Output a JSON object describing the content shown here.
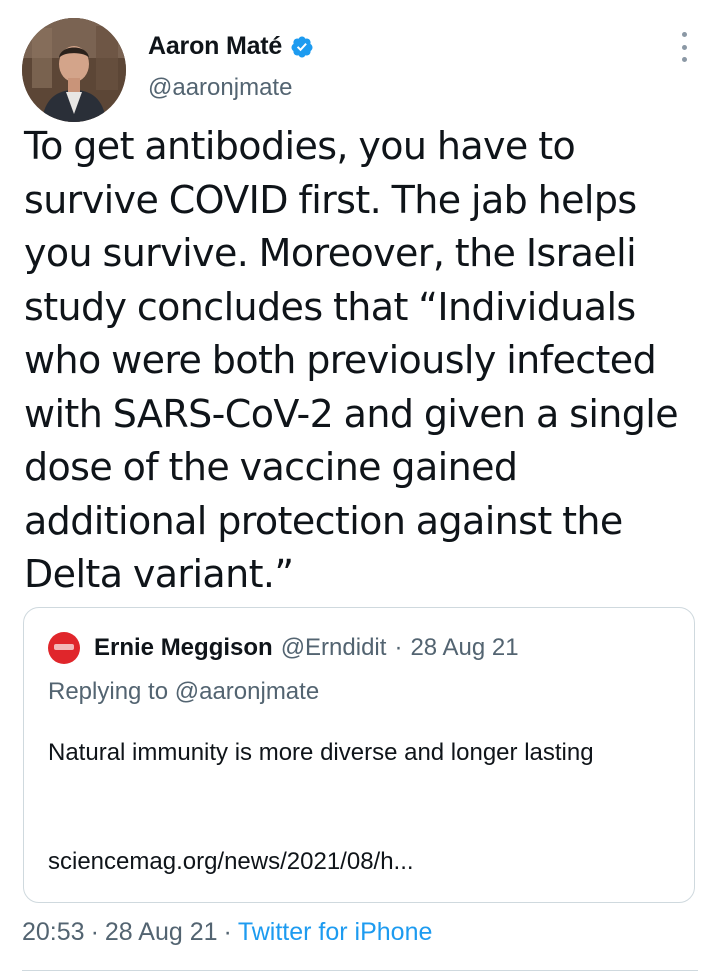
{
  "author": {
    "display_name": "Aaron Maté",
    "handle": "@aaronjmate",
    "verified": true
  },
  "tweet": {
    "text": "To get antibodies, you have to survive COVID first. The jab helps you survive. Moreover, the Israeli study concludes that “Individuals who were both previously infected with SARS-CoV-2 and given a single dose of the vaccine gained additional protection against the Delta variant.”",
    "time": "20:53",
    "date": "28 Aug 21",
    "source": "Twitter for iPhone",
    "separator": "·"
  },
  "quote": {
    "display_name": "Ernie Meggison",
    "handle": "@Erndidit",
    "separator": "·",
    "date": "28 Aug 21",
    "replying_to": "Replying to @aaronjmate",
    "text": "Natural immunity is more diverse and longer lasting",
    "link": "sciencemag.org/news/2021/08/h..."
  },
  "colors": {
    "verified": "#1d9bf0",
    "secondary_text": "#536471",
    "link": "#1d9bf0"
  },
  "icons": {
    "verified": "verified-badge-icon",
    "more": "more-options-icon"
  }
}
